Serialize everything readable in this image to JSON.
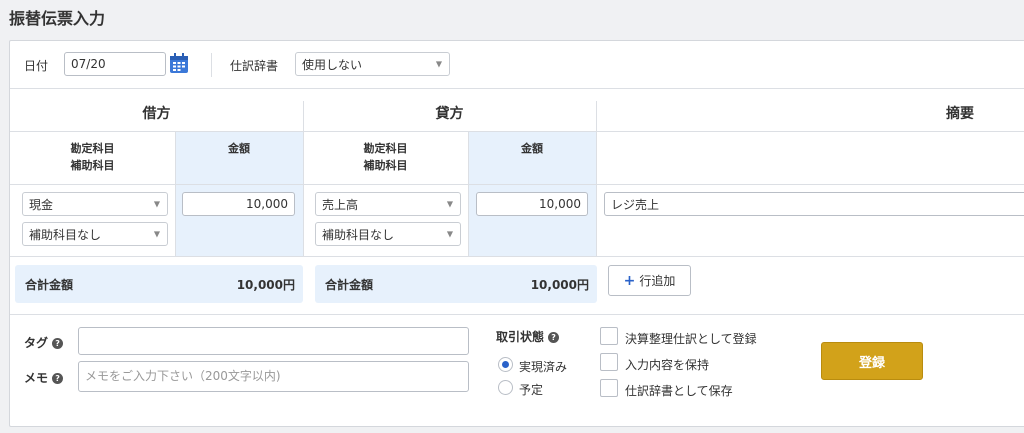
{
  "page": {
    "title": "振替伝票入力"
  },
  "top": {
    "date_label": "日付",
    "date_value": "07/20",
    "dictionary_label": "仕訳辞書",
    "dictionary_value": "使用しない"
  },
  "debit": {
    "heading": "借方",
    "account_header_line1": "勘定科目",
    "account_header_line2": "補助科目",
    "amount_header": "金額",
    "account": "現金",
    "sub_account": "補助科目なし",
    "amount": "10,000",
    "total_label": "合計金額",
    "total_value": "10,000円"
  },
  "credit": {
    "heading": "貸方",
    "account_header_line1": "勘定科目",
    "account_header_line2": "補助科目",
    "amount_header": "金額",
    "account": "売上高",
    "sub_account": "補助科目なし",
    "amount": "10,000",
    "total_label": "合計金額",
    "total_value": "10,000円"
  },
  "memo_col": {
    "heading": "摘要",
    "value": "レジ売上"
  },
  "add_row_label": "行追加",
  "tag": {
    "label": "タグ",
    "value": ""
  },
  "memo": {
    "label": "メモ",
    "placeholder": "メモをご入力下さい（200文字以内)"
  },
  "status": {
    "label": "取引状態",
    "options": [
      {
        "label": "実現済み",
        "checked": true
      },
      {
        "label": "予定",
        "checked": false
      }
    ]
  },
  "options": [
    {
      "label": "決算整理仕訳として登録"
    },
    {
      "label": "入力内容を保持"
    },
    {
      "label": "仕訳辞書として保存"
    }
  ],
  "register_label": "登録",
  "colors": {
    "accent": "#d2a21a",
    "amount_bg": "#e7f1fc",
    "link_blue": "#2a62c9"
  },
  "icons": {
    "calendar": "calendar-icon",
    "help": "help-icon",
    "plus": "plus-icon"
  }
}
